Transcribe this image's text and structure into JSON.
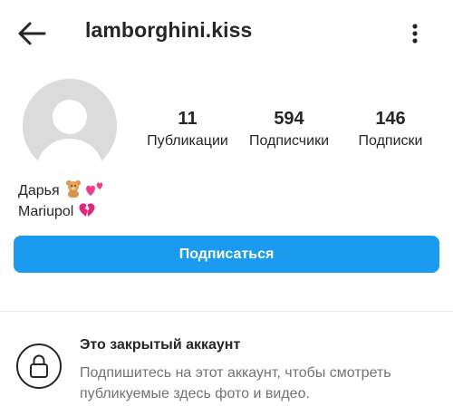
{
  "header": {
    "back_icon": "arrow-left-icon",
    "username": "lamborghini.kiss",
    "more_icon": "more-vertical-icon"
  },
  "profile": {
    "avatar_icon": "default-avatar-icon",
    "stats": [
      {
        "count": "11",
        "label": "Публикации"
      },
      {
        "count": "594",
        "label": "Подписчики"
      },
      {
        "count": "146",
        "label": "Подписки"
      }
    ],
    "bio": {
      "name": "Дарья",
      "name_emojis": [
        "teddy-bear-emoji",
        "two-hearts-emoji"
      ],
      "location": "Mariupol",
      "location_emojis": [
        "broken-heart-emoji"
      ]
    }
  },
  "actions": {
    "follow_label": "Подписаться",
    "follow_color": "#1a9bf0"
  },
  "private_account": {
    "lock_icon": "lock-icon",
    "title": "Это закрытый аккаунт",
    "description": "Подпишитесь на этот аккаунт, чтобы смотреть публикуемые здесь фото и видео."
  }
}
